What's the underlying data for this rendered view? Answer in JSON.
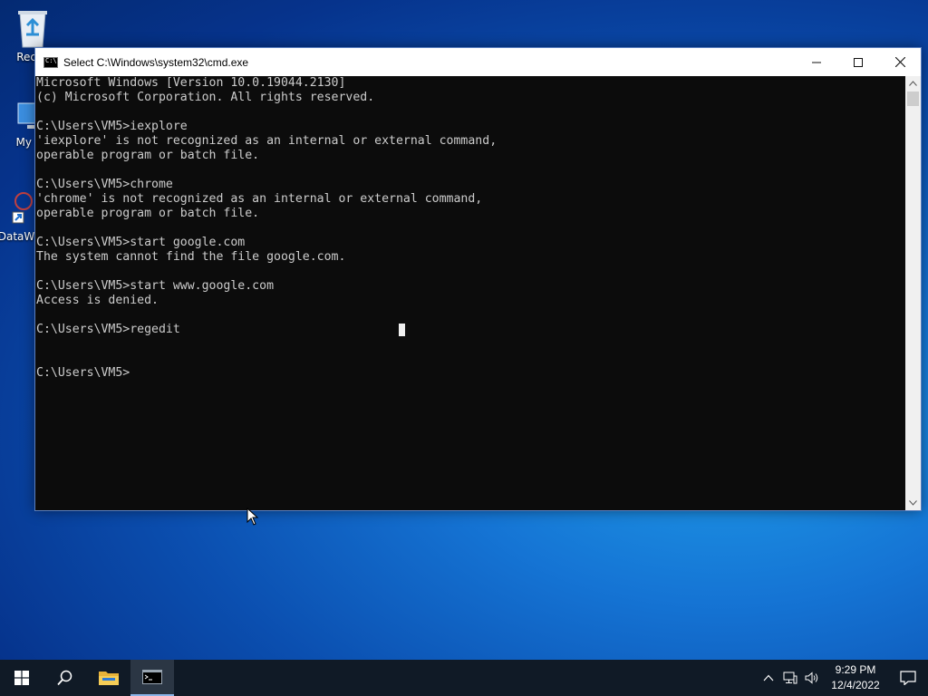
{
  "desktop": {
    "icons": [
      {
        "label": "Recyc",
        "icon": "recycle-bin-icon"
      },
      {
        "label": "My Co",
        "icon": "computer-icon"
      },
      {
        "label": "DataW",
        "icon": "shortcut-icon"
      }
    ]
  },
  "window": {
    "title": "Select C:\\Windows\\system32\\cmd.exe",
    "controls": {
      "minimize": "minimize",
      "maximize": "maximize",
      "close": "close"
    }
  },
  "console": {
    "lines": "Microsoft Windows [Version 10.0.19044.2130]\n(c) Microsoft Corporation. All rights reserved.\n\nC:\\Users\\VM5>iexplore\n'iexplore' is not recognized as an internal or external command,\noperable program or batch file.\n\nC:\\Users\\VM5>chrome\n'chrome' is not recognized as an internal or external command,\noperable program or batch file.\n\nC:\\Users\\VM5>start google.com\nThe system cannot find the file google.com.\n\nC:\\Users\\VM5>start www.google.com\nAccess is denied.\n\nC:\\Users\\VM5>regedit\n\n\nC:\\Users\\VM5>",
    "background": "#0c0c0c",
    "foreground": "#cccccc"
  },
  "taskbar": {
    "buttons": [
      "start-button",
      "search-button",
      "file-explorer-button",
      "cmd-taskbar-button"
    ],
    "clock": {
      "time": "9:29 PM",
      "date": "12/4/2022"
    }
  }
}
